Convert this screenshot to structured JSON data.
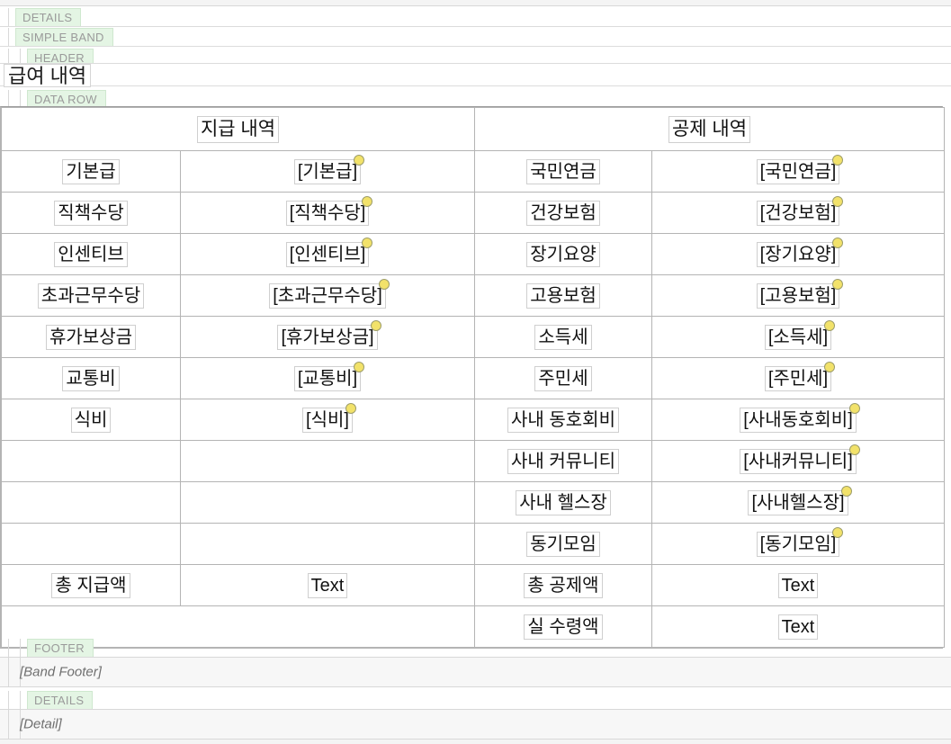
{
  "bands": {
    "details_top": "DETAILS",
    "simple_band": "SIMPLE BAND",
    "header": "HEADER",
    "data_row": "DATA ROW",
    "footer": "FOOTER",
    "details_bottom": "DETAILS"
  },
  "report": {
    "title": "급여 내역",
    "band_footer_placeholder": "[Band Footer]",
    "detail_placeholder": "[Detail]"
  },
  "colors": {
    "band_chip_bg": "#e4f5e4",
    "band_chip_border": "#cfe8cf",
    "band_chip_text": "#9a9a9a",
    "marker": "#f2e26a",
    "marker_border": "#9d9d6a",
    "table_border": "#b4b4b4",
    "field_border": "#cfcfcf",
    "placeholder_text": "#6f6f6f"
  },
  "table": {
    "headers": [
      {
        "label": "지급 내역",
        "colspan": 2
      },
      {
        "label": "공제 내역",
        "colspan": 2
      }
    ],
    "rows": [
      {
        "pay_label": "기본급",
        "pay_value": "[기본급]",
        "pay_bound": true,
        "ded_label": "국민연금",
        "ded_value": "[국민연금]",
        "ded_bound": true
      },
      {
        "pay_label": "직책수당",
        "pay_value": "[직책수당]",
        "pay_bound": true,
        "ded_label": "건강보험",
        "ded_value": "[건강보험]",
        "ded_bound": true
      },
      {
        "pay_label": "인센티브",
        "pay_value": "[인센티브]",
        "pay_bound": true,
        "ded_label": "장기요양",
        "ded_value": "[장기요양]",
        "ded_bound": true
      },
      {
        "pay_label": "초과근무수당",
        "pay_value": "[초과근무수당]",
        "pay_bound": true,
        "ded_label": "고용보험",
        "ded_value": "[고용보험]",
        "ded_bound": true
      },
      {
        "pay_label": "휴가보상금",
        "pay_value": "[휴가보상금]",
        "pay_bound": true,
        "ded_label": "소득세",
        "ded_value": "[소득세]",
        "ded_bound": true
      },
      {
        "pay_label": "교통비",
        "pay_value": "[교통비]",
        "pay_bound": true,
        "ded_label": "주민세",
        "ded_value": "[주민세]",
        "ded_bound": true
      },
      {
        "pay_label": "식비",
        "pay_value": "[식비]",
        "pay_bound": true,
        "ded_label": "사내 동호회비",
        "ded_value": "[사내동호회비]",
        "ded_bound": true
      },
      {
        "pay_label": "",
        "pay_value": "",
        "pay_bound": false,
        "ded_label": "사내 커뮤니티",
        "ded_value": "[사내커뮤니티]",
        "ded_bound": true
      },
      {
        "pay_label": "",
        "pay_value": "",
        "pay_bound": false,
        "ded_label": "사내 헬스장",
        "ded_value": "[사내헬스장]",
        "ded_bound": true
      },
      {
        "pay_label": "",
        "pay_value": "",
        "pay_bound": false,
        "ded_label": "동기모임",
        "ded_value": "[동기모임]",
        "ded_bound": true
      },
      {
        "pay_label": "총 지급액",
        "pay_value": "Text",
        "pay_bound": false,
        "ded_label": "총 공제액",
        "ded_value": "Text",
        "ded_bound": false
      },
      {
        "pay_label": "",
        "pay_value": "",
        "pay_bound": false,
        "pay_merged": true,
        "ded_label": "실 수령액",
        "ded_value": "Text",
        "ded_bound": false
      }
    ]
  }
}
